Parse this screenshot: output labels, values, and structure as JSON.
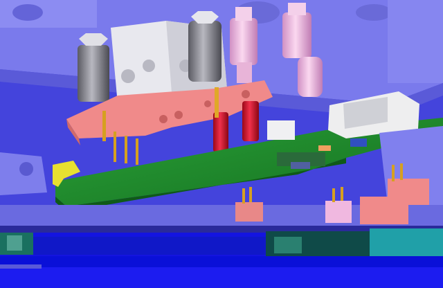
{
  "scene": {
    "kind": "3D CAD render of a PCB test fixture",
    "colors": {
      "background_blue": "#4a4ae6",
      "plate_lavender": "#8080ee",
      "pcb_green": "#1f8a2a",
      "pink_block": "#f08a8a",
      "red_pin": "#d9102a",
      "gray_cylinder": "#7d7d86",
      "light_pink_probe": "#f0b8e0",
      "gold_pin": "#d6a020",
      "yellow_clip": "#e8e030",
      "white_block": "#eeeef0"
    }
  }
}
